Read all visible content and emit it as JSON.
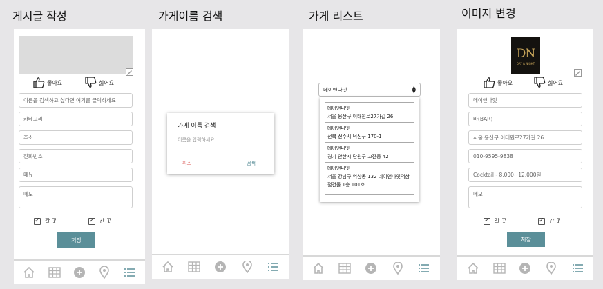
{
  "titles": [
    "게시글 작성",
    "가게이름 검색",
    "가게 리스트",
    "이미지 변경"
  ],
  "post": {
    "like": "좋아요",
    "dislike": "싫어요",
    "fields": [
      "이름을 검색하고 싶다면 여기를 클릭하세요",
      "카테고리",
      "주소",
      "전화번호",
      "메뉴"
    ],
    "memo": "메모",
    "check1": "갈 곳",
    "check2": "간 곳",
    "save": "저장"
  },
  "search_dialog": {
    "title": "가게 이름 검색",
    "placeholder": "이름을 입력하세요",
    "cancel": "취소",
    "search": "검색"
  },
  "store_list": {
    "selected": "데이앤나잇",
    "items": [
      {
        "name": "데이앤나잇",
        "address": "서울 용산구 이태원로27가길 26"
      },
      {
        "name": "데이앤나잇",
        "address": "전북 전주시 덕진구 170-1"
      },
      {
        "name": "데이앤나잇",
        "address": "경기 안산시 단원구 고잔동 42"
      },
      {
        "name": "데이앤나잇",
        "address": "서울 강남구 역삼동 132 데이앤나잇역삼점건물 1층 101호"
      }
    ]
  },
  "image_edit": {
    "logo_text": "DN",
    "logo_sub": "DAY & NIGHT",
    "like": "좋아요",
    "dislike": "싫어요",
    "fields": [
      "데이앤나잇",
      "바(BAR)",
      "서울 용산구 이태원로27가길 26",
      "010-9595-9838",
      "Cocktail - 8,000~12,000원"
    ],
    "memo": "메모",
    "check1": "갈 곳",
    "check2": "간 곳",
    "save": "저장"
  },
  "colors": {
    "accent": "#5b8f99",
    "cancel": "#d9534f",
    "nav_icon_active": "#5b8f99",
    "nav_icon": "#b5b5b5"
  },
  "nav_icons": [
    "home-icon",
    "grid-icon",
    "add-icon",
    "map-pin-icon",
    "list-icon"
  ]
}
